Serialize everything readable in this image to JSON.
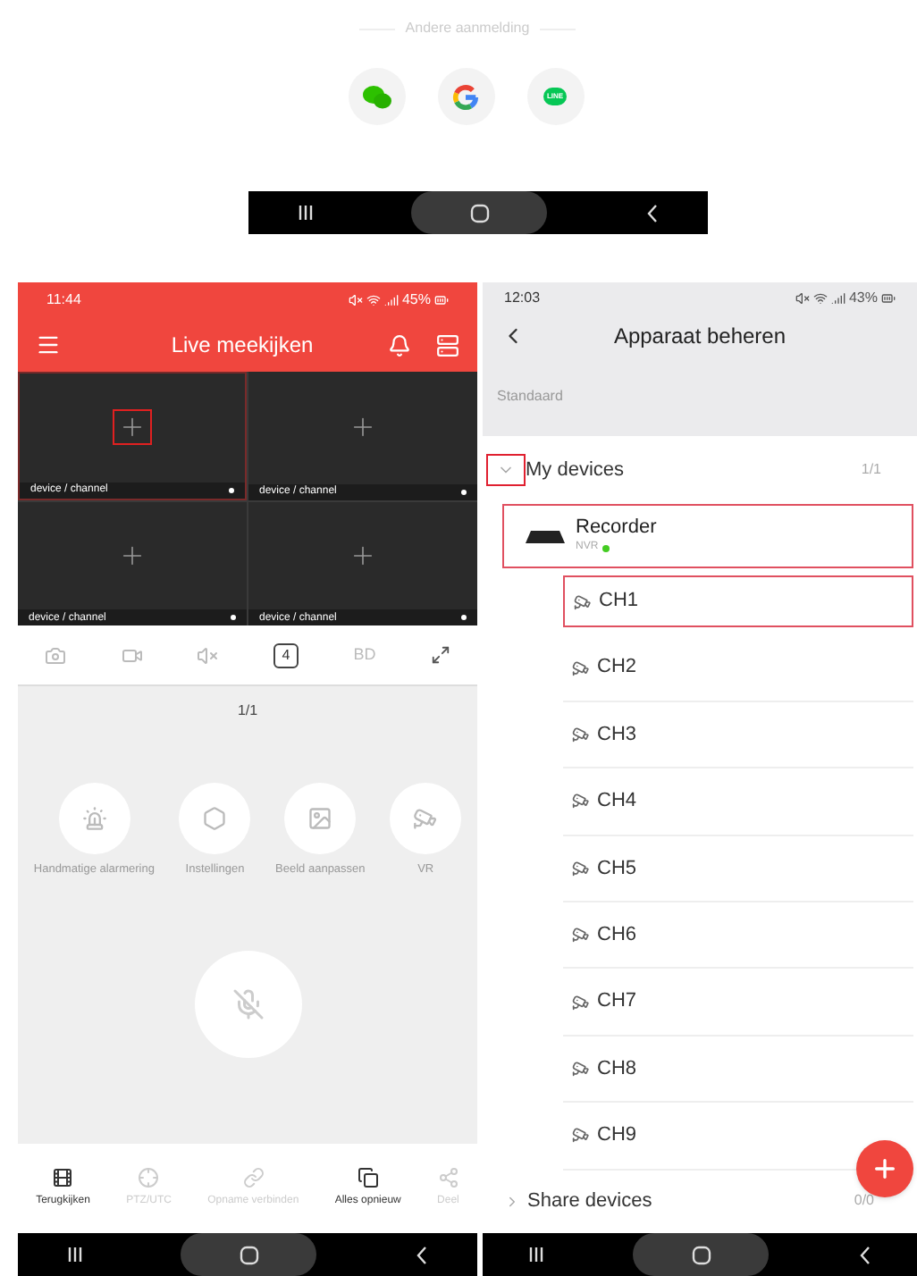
{
  "login_options": {
    "divider_label": "Andere aanmelding",
    "providers": [
      {
        "kind": "wechat"
      },
      {
        "kind": "google"
      },
      {
        "kind": "line",
        "label": "LINE"
      }
    ]
  },
  "live_screen": {
    "status_bar": {
      "time": "11:44",
      "battery": "45%"
    },
    "title": "Live meekijken",
    "tiles": [
      {
        "label": "device / channel",
        "outlined": true
      },
      {
        "label": "device / channel",
        "outlined": false
      },
      {
        "label": "device / channel",
        "outlined": false
      },
      {
        "label": "device / channel",
        "outlined": false
      }
    ],
    "toolbar": {
      "split_count": "4",
      "quality": "BD"
    },
    "page": "1/1",
    "actions": [
      {
        "kind": "alarm",
        "label": "Handmatige alarmering"
      },
      {
        "kind": "settings",
        "label": "Instellingen"
      },
      {
        "kind": "image",
        "label": "Beeld aanpassen"
      },
      {
        "kind": "vr",
        "label": "VR"
      }
    ],
    "bottom_tabs": [
      {
        "kind": "playback",
        "label": "Terugkijken",
        "disabled": false
      },
      {
        "kind": "ptz",
        "label": "PTZ/UTC",
        "disabled": true
      },
      {
        "kind": "record",
        "label": "Opname verbinden",
        "disabled": true
      },
      {
        "kind": "reload",
        "label": "Alles opnieuw",
        "disabled": false
      },
      {
        "kind": "share",
        "label": "Deel",
        "disabled": true
      }
    ]
  },
  "device_screen": {
    "status_bar": {
      "time": "12:03",
      "battery": "43%"
    },
    "title": "Apparaat beheren",
    "group_label": "Standaard",
    "tree": [
      {
        "label": "My devices",
        "count": "1/1",
        "expanded": true,
        "outlined": true,
        "children": [
          {
            "label": "Recorder",
            "type": "NVR",
            "online": true,
            "outlined": true,
            "children": [
              {
                "label": "CH1",
                "outlined": true
              },
              {
                "label": "CH2",
                "outlined": false
              },
              {
                "label": "CH3",
                "outlined": false
              },
              {
                "label": "CH4",
                "outlined": false
              },
              {
                "label": "CH5",
                "outlined": false
              },
              {
                "label": "CH6",
                "outlined": false
              },
              {
                "label": "CH7",
                "outlined": false
              },
              {
                "label": "CH8",
                "outlined": false
              },
              {
                "label": "CH9",
                "outlined": false
              }
            ]
          }
        ]
      },
      {
        "label": "Share devices",
        "count": "0/0",
        "expanded": false
      }
    ]
  }
}
